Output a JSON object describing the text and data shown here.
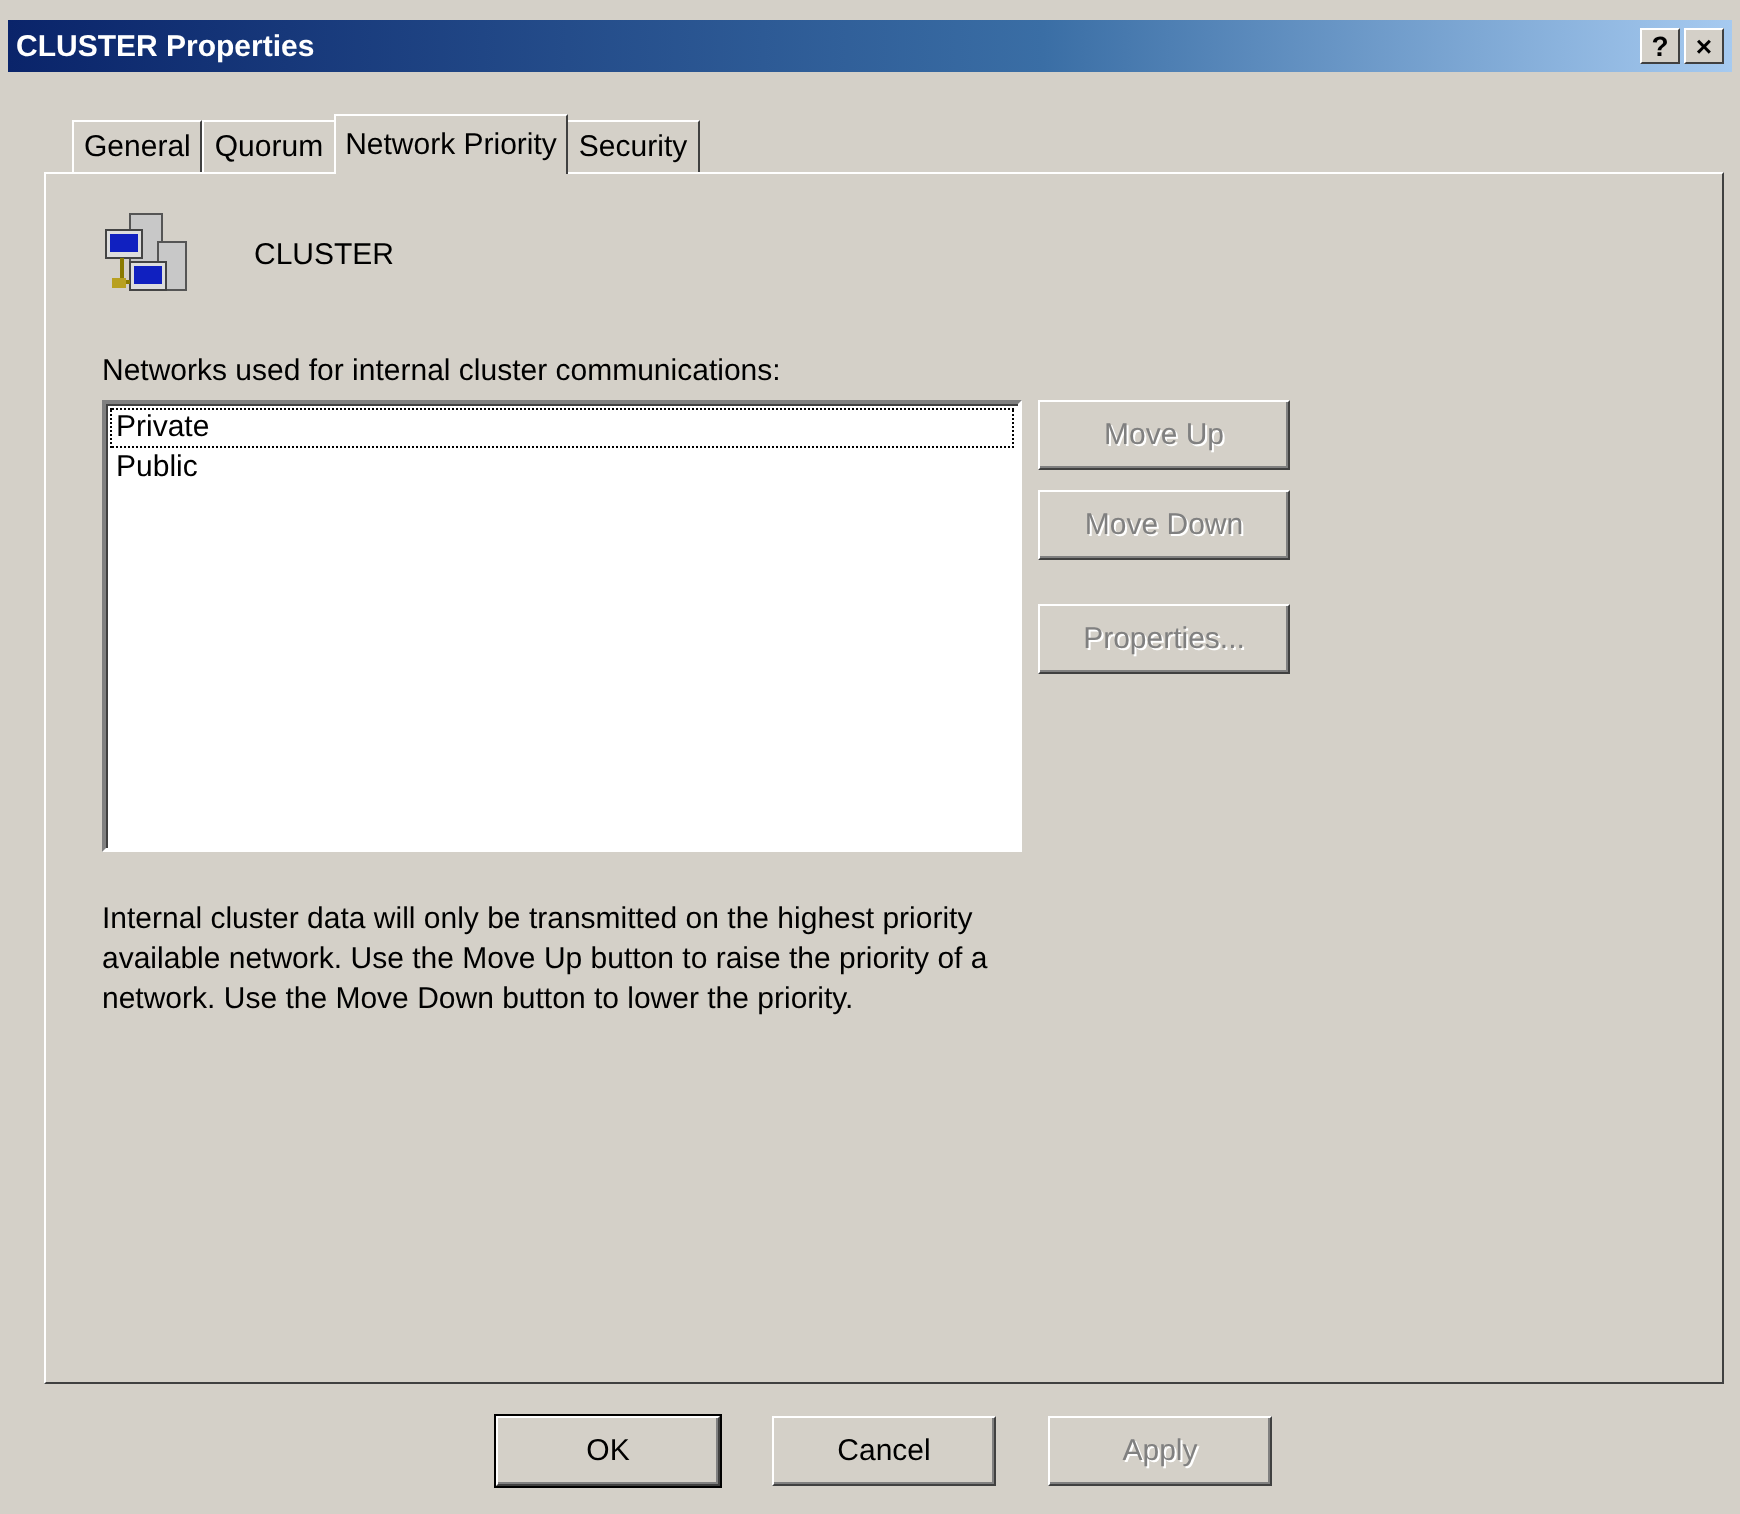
{
  "window": {
    "title": "CLUSTER Properties",
    "controls": [
      "?",
      "×"
    ]
  },
  "tabs": [
    {
      "label": "General",
      "selected": false
    },
    {
      "label": "Quorum",
      "selected": false
    },
    {
      "label": "Network Priority",
      "selected": true
    },
    {
      "label": "Security",
      "selected": false
    }
  ],
  "header": {
    "name": "CLUSTER"
  },
  "networks": {
    "label": "Networks used for internal cluster communications:",
    "items": [
      {
        "label": "Private",
        "selected": true
      },
      {
        "label": "Public",
        "selected": false
      }
    ]
  },
  "side_buttons": [
    {
      "label": "Move Up",
      "disabled": true
    },
    {
      "label": "Move Down",
      "disabled": true
    },
    {
      "label": "Properties...",
      "disabled": true
    }
  ],
  "description": "Internal cluster data will only be transmitted on the highest priority available network. Use the Move Up button to raise the priority of a network. Use the Move Down button to lower the priority.",
  "buttons": [
    {
      "label": "OK",
      "disabled": false,
      "default": true
    },
    {
      "label": "Cancel",
      "disabled": false,
      "default": false
    },
    {
      "label": "Apply",
      "disabled": true,
      "default": false
    }
  ]
}
